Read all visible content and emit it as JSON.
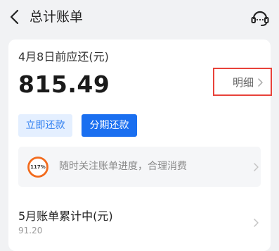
{
  "header": {
    "title": "总计账单",
    "back_icon": "chevron-left-icon",
    "service_icon": "headset-icon"
  },
  "bill": {
    "due_label": "4月8日前应还(元)",
    "amount": "815.49",
    "detail_label": "明细"
  },
  "actions": {
    "repay_label": "立即还款",
    "installment_label": "分期还款"
  },
  "tip": {
    "progress_text": "117%",
    "progress_fraction": 1.17,
    "text": "随时关注账单进度，合理消费"
  },
  "accumulating": {
    "label": "5月账单累计中(元)",
    "value": "91.20"
  },
  "colors": {
    "primary": "#1a6ff0",
    "primary_light": "#e4efff",
    "highlight_border": "#e8423a",
    "progress_ring": "#f26b1d"
  }
}
